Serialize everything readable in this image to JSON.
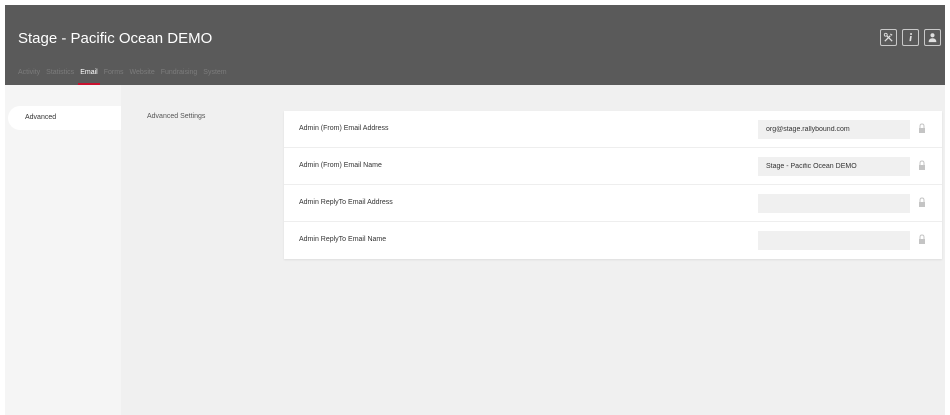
{
  "header": {
    "title": "Stage - Pacific Ocean DEMO",
    "icons": [
      "tools-icon",
      "info-icon",
      "user-icon"
    ]
  },
  "nav": {
    "items": [
      {
        "label": "Activity",
        "active": false
      },
      {
        "label": "Statistics",
        "active": false
      },
      {
        "label": "Email",
        "active": true
      },
      {
        "label": "Forms",
        "active": false
      },
      {
        "label": "Website",
        "active": false
      },
      {
        "label": "Fundraising",
        "active": false
      },
      {
        "label": "System",
        "active": false
      }
    ]
  },
  "sidebar": {
    "items": [
      {
        "label": "Advanced",
        "active": true
      }
    ]
  },
  "main": {
    "section_title": "Advanced Settings",
    "rows": [
      {
        "label": "Admin (From) Email Address",
        "value": "org@stage.rallybound.com"
      },
      {
        "label": "Admin (From) Email Name",
        "value": "Stage - Pacific Ocean DEMO"
      },
      {
        "label": "Admin ReplyTo Email Address",
        "value": ""
      },
      {
        "label": "Admin ReplyTo Email Name",
        "value": ""
      }
    ]
  },
  "colors": {
    "topbar": "#5a5a5a",
    "accent": "#c8102e",
    "background": "#f0f0f0"
  }
}
